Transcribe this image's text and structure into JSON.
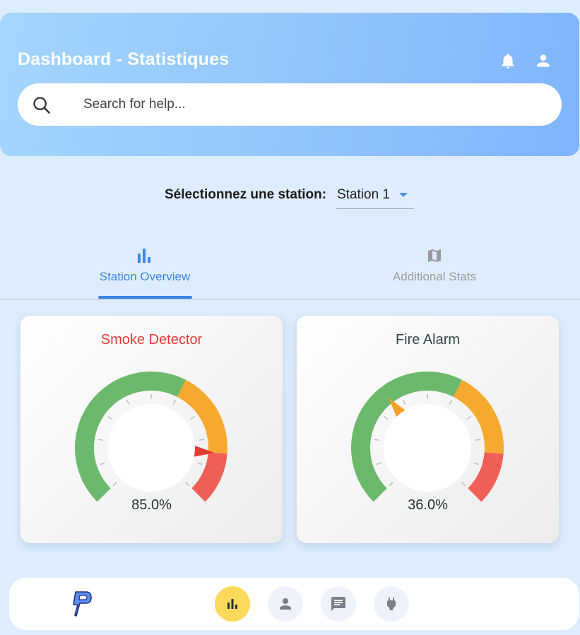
{
  "header": {
    "title": "Dashboard - Statistiques",
    "notification_icon": "bell-icon",
    "account_icon": "person-icon"
  },
  "search": {
    "placeholder": "Search for help...",
    "value": ""
  },
  "station_selector": {
    "label": "Sélectionnez une station:",
    "selected": "Station 1"
  },
  "tabs": [
    {
      "label": "Station Overview",
      "icon": "bar-chart-icon",
      "active": true
    },
    {
      "label": "Additional Stats",
      "icon": "map-icon",
      "active": false
    }
  ],
  "gauges": [
    {
      "title": "Smoke Detector",
      "value": 85.0,
      "value_text": "85.0%",
      "title_color": "#e53935",
      "needle_color": "#e53935"
    },
    {
      "title": "Fire Alarm",
      "value": 36.0,
      "value_text": "36.0%",
      "title_color": "#37474f",
      "needle_color": "#f6a02d"
    }
  ],
  "gauge_ranges": {
    "min": 0,
    "max": 100,
    "green_to": 60,
    "orange_to": 85,
    "colors": {
      "green": "#6cb86c",
      "orange": "#f6a92f",
      "red": "#ef5f57"
    }
  },
  "bottom_nav": {
    "items": [
      {
        "name": "stats",
        "icon": "bar-chart-icon",
        "active": true
      },
      {
        "name": "profile",
        "icon": "person-icon",
        "active": false
      },
      {
        "name": "messages",
        "icon": "chat-icon",
        "active": false
      },
      {
        "name": "power",
        "icon": "plug-icon",
        "active": false
      }
    ]
  },
  "colors": {
    "accent": "#3d86e6",
    "background": "#deedfd",
    "active_nav": "#fcd95b"
  }
}
